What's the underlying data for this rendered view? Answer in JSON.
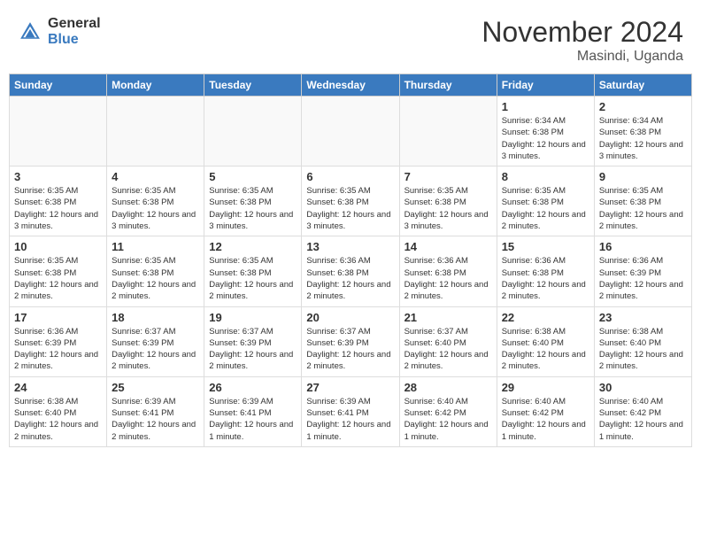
{
  "logo": {
    "general": "General",
    "blue": "Blue"
  },
  "title": "November 2024",
  "location": "Masindi, Uganda",
  "days_of_week": [
    "Sunday",
    "Monday",
    "Tuesday",
    "Wednesday",
    "Thursday",
    "Friday",
    "Saturday"
  ],
  "weeks": [
    [
      {
        "day": "",
        "info": ""
      },
      {
        "day": "",
        "info": ""
      },
      {
        "day": "",
        "info": ""
      },
      {
        "day": "",
        "info": ""
      },
      {
        "day": "",
        "info": ""
      },
      {
        "day": "1",
        "info": "Sunrise: 6:34 AM\nSunset: 6:38 PM\nDaylight: 12 hours and 3 minutes."
      },
      {
        "day": "2",
        "info": "Sunrise: 6:34 AM\nSunset: 6:38 PM\nDaylight: 12 hours and 3 minutes."
      }
    ],
    [
      {
        "day": "3",
        "info": "Sunrise: 6:35 AM\nSunset: 6:38 PM\nDaylight: 12 hours and 3 minutes."
      },
      {
        "day": "4",
        "info": "Sunrise: 6:35 AM\nSunset: 6:38 PM\nDaylight: 12 hours and 3 minutes."
      },
      {
        "day": "5",
        "info": "Sunrise: 6:35 AM\nSunset: 6:38 PM\nDaylight: 12 hours and 3 minutes."
      },
      {
        "day": "6",
        "info": "Sunrise: 6:35 AM\nSunset: 6:38 PM\nDaylight: 12 hours and 3 minutes."
      },
      {
        "day": "7",
        "info": "Sunrise: 6:35 AM\nSunset: 6:38 PM\nDaylight: 12 hours and 3 minutes."
      },
      {
        "day": "8",
        "info": "Sunrise: 6:35 AM\nSunset: 6:38 PM\nDaylight: 12 hours and 2 minutes."
      },
      {
        "day": "9",
        "info": "Sunrise: 6:35 AM\nSunset: 6:38 PM\nDaylight: 12 hours and 2 minutes."
      }
    ],
    [
      {
        "day": "10",
        "info": "Sunrise: 6:35 AM\nSunset: 6:38 PM\nDaylight: 12 hours and 2 minutes."
      },
      {
        "day": "11",
        "info": "Sunrise: 6:35 AM\nSunset: 6:38 PM\nDaylight: 12 hours and 2 minutes."
      },
      {
        "day": "12",
        "info": "Sunrise: 6:35 AM\nSunset: 6:38 PM\nDaylight: 12 hours and 2 minutes."
      },
      {
        "day": "13",
        "info": "Sunrise: 6:36 AM\nSunset: 6:38 PM\nDaylight: 12 hours and 2 minutes."
      },
      {
        "day": "14",
        "info": "Sunrise: 6:36 AM\nSunset: 6:38 PM\nDaylight: 12 hours and 2 minutes."
      },
      {
        "day": "15",
        "info": "Sunrise: 6:36 AM\nSunset: 6:38 PM\nDaylight: 12 hours and 2 minutes."
      },
      {
        "day": "16",
        "info": "Sunrise: 6:36 AM\nSunset: 6:39 PM\nDaylight: 12 hours and 2 minutes."
      }
    ],
    [
      {
        "day": "17",
        "info": "Sunrise: 6:36 AM\nSunset: 6:39 PM\nDaylight: 12 hours and 2 minutes."
      },
      {
        "day": "18",
        "info": "Sunrise: 6:37 AM\nSunset: 6:39 PM\nDaylight: 12 hours and 2 minutes."
      },
      {
        "day": "19",
        "info": "Sunrise: 6:37 AM\nSunset: 6:39 PM\nDaylight: 12 hours and 2 minutes."
      },
      {
        "day": "20",
        "info": "Sunrise: 6:37 AM\nSunset: 6:39 PM\nDaylight: 12 hours and 2 minutes."
      },
      {
        "day": "21",
        "info": "Sunrise: 6:37 AM\nSunset: 6:40 PM\nDaylight: 12 hours and 2 minutes."
      },
      {
        "day": "22",
        "info": "Sunrise: 6:38 AM\nSunset: 6:40 PM\nDaylight: 12 hours and 2 minutes."
      },
      {
        "day": "23",
        "info": "Sunrise: 6:38 AM\nSunset: 6:40 PM\nDaylight: 12 hours and 2 minutes."
      }
    ],
    [
      {
        "day": "24",
        "info": "Sunrise: 6:38 AM\nSunset: 6:40 PM\nDaylight: 12 hours and 2 minutes."
      },
      {
        "day": "25",
        "info": "Sunrise: 6:39 AM\nSunset: 6:41 PM\nDaylight: 12 hours and 2 minutes."
      },
      {
        "day": "26",
        "info": "Sunrise: 6:39 AM\nSunset: 6:41 PM\nDaylight: 12 hours and 1 minute."
      },
      {
        "day": "27",
        "info": "Sunrise: 6:39 AM\nSunset: 6:41 PM\nDaylight: 12 hours and 1 minute."
      },
      {
        "day": "28",
        "info": "Sunrise: 6:40 AM\nSunset: 6:42 PM\nDaylight: 12 hours and 1 minute."
      },
      {
        "day": "29",
        "info": "Sunrise: 6:40 AM\nSunset: 6:42 PM\nDaylight: 12 hours and 1 minute."
      },
      {
        "day": "30",
        "info": "Sunrise: 6:40 AM\nSunset: 6:42 PM\nDaylight: 12 hours and 1 minute."
      }
    ]
  ]
}
